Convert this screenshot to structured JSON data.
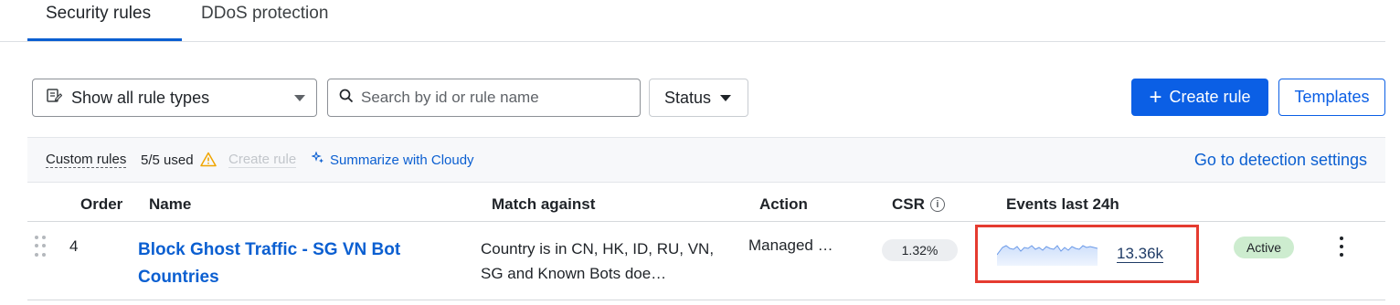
{
  "tabs": [
    {
      "label": "Security rules",
      "active": true
    },
    {
      "label": "DDoS protection",
      "active": false
    }
  ],
  "toolbar": {
    "rule_type_select": {
      "value": "Show all rule types",
      "icon": "rule-list-icon"
    },
    "search": {
      "placeholder": "Search by id or rule name",
      "value": ""
    },
    "status_select": {
      "label": "Status"
    },
    "create_rule_label": "Create rule",
    "templates_label": "Templates"
  },
  "info_bar": {
    "custom_rules_label": "Custom rules",
    "used_count": "5/5 used",
    "create_rule_link": "Create rule",
    "cloudy_link": "Summarize with Cloudy",
    "detection_link": "Go to detection settings"
  },
  "table": {
    "headers": {
      "order": "Order",
      "name": "Name",
      "match": "Match against",
      "action": "Action",
      "csr": "CSR",
      "events": "Events last 24h"
    },
    "rows": [
      {
        "order": "4",
        "name": "Block Ghost Traffic - SG VN Bot Countries",
        "match": "Country is in CN, HK, ID, RU, VN, SG and Known Bots doe…",
        "action": "Managed …",
        "csr": "1.32%",
        "events_count": "13.36k",
        "status": "Active"
      }
    ]
  },
  "colors": {
    "accent": "#0b5fe5",
    "link": "#0b5fd1",
    "highlight_box": "#e53b30",
    "active_badge": "#cdeccf",
    "warning": "#f0a500"
  }
}
